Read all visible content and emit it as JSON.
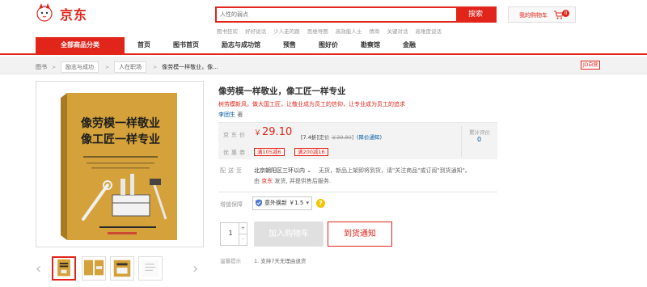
{
  "header": {
    "logo_text": "京东",
    "search_placeholder": "人性的弱点",
    "search_button": "搜索",
    "hotwords": [
      "图书狂欢",
      "好好说话",
      "少人走的路",
      "思维导图",
      "高效能人士",
      "情商",
      "关键对话",
      "高难度谈话"
    ],
    "cart_label": "我的购物车",
    "cart_count": "0"
  },
  "nav": {
    "all_categories": "全部商品分类",
    "items": [
      "首页",
      "图书首页",
      "励志与成功馆",
      "预售",
      "图好价",
      "勘察馆",
      "金融"
    ]
  },
  "breadcrumb": {
    "items": [
      "图书",
      "励志与成功",
      "人在职场"
    ],
    "current": "像劳模一样敬业，像...",
    "badge": "JD自营"
  },
  "book_cover": {
    "title_line1": "像劳模一样敬业",
    "title_line2": "像工匠一样专业",
    "cover_color": "#d4a13a"
  },
  "product": {
    "title": "像劳模一样敬业，像工匠一样专业",
    "slogan": "树劳模新风，做大国工匠，让敬业成为员工的信仰，让专业成为员工的追求",
    "author_name": "李团生",
    "author_suffix": "著"
  },
  "price": {
    "label": "京东价",
    "currency": "￥",
    "value": "29.10",
    "discount": "[7.4折]",
    "orig_label": "[定价",
    "orig_value": "￥39.80",
    "orig_close": "]",
    "notify": "(降价通知)",
    "coupon_label": "优惠券",
    "coupons": [
      "满105减6",
      "满200减16"
    ],
    "rating_label": "累计评价",
    "rating_value": "0"
  },
  "shipping": {
    "label": "配送至",
    "location": "北京朝阳区三环以内",
    "message": "无货，新品上架即将到货，请\"关注商品\"或订阅\"到货通知\"。",
    "by_prefix": "由",
    "by_jd": "京东",
    "by_suffix": "发货, 并提供售后服务."
  },
  "service": {
    "label": "增值保障",
    "option": "意外换新 ￥1.5",
    "help": "?"
  },
  "purchase": {
    "quantity": "1",
    "add_to_cart": "加入购物车",
    "notify_arrival": "到货通知"
  },
  "tips": {
    "label": "温馨提示",
    "text": "1. 支持7天无理由退货"
  },
  "colors": {
    "brand_red": "#e1251b",
    "link_blue": "#005aa0"
  }
}
